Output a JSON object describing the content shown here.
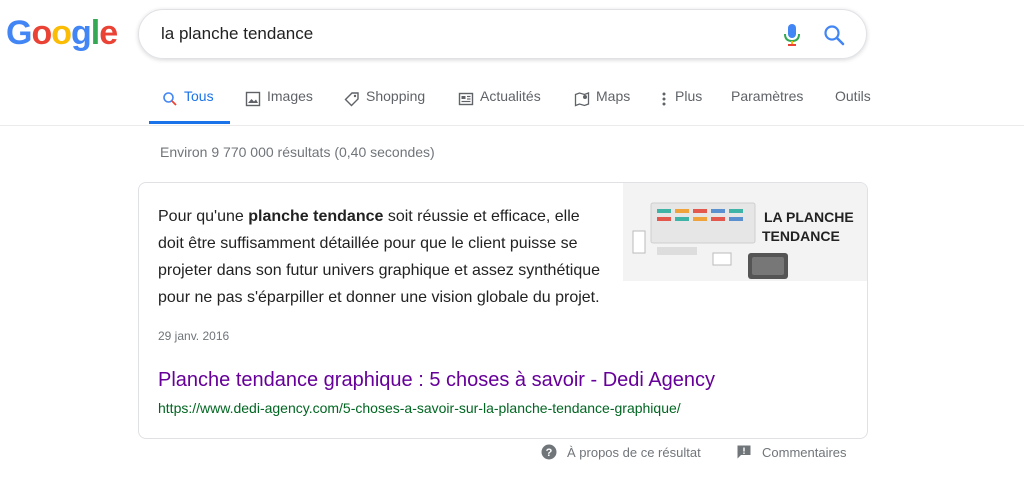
{
  "logo": {
    "letters": [
      "G",
      "o",
      "o",
      "g",
      "l",
      "e"
    ],
    "colors": [
      "#4285F4",
      "#EA4335",
      "#FBBC05",
      "#4285F4",
      "#34A853",
      "#EA4335"
    ]
  },
  "search": {
    "query": "la planche tendance"
  },
  "tabs": [
    {
      "label": "Tous",
      "icon": "search-icon",
      "active": true
    },
    {
      "label": "Images",
      "icon": "image-icon"
    },
    {
      "label": "Shopping",
      "icon": "tag-icon"
    },
    {
      "label": "Actualités",
      "icon": "news-icon"
    },
    {
      "label": "Maps",
      "icon": "map-icon"
    },
    {
      "label": "Plus",
      "icon": "more-vert-icon"
    },
    {
      "label": "Paramètres"
    },
    {
      "label": "Outils"
    }
  ],
  "stats": "Environ 9 770 000 résultats (0,40 secondes)",
  "featured": {
    "snippet_pre": "Pour qu'une ",
    "snippet_bold": "planche tendance",
    "snippet_post": " soit réussie et efficace, elle doit être suffisamment détaillée pour que le client puisse se projeter dans son futur univers graphique et assez synthétique pour ne pas s'éparpiller et donner une vision globale du projet.",
    "date": "29 janv. 2016",
    "title": "Planche tendance graphique : 5 choses à savoir - Dedi Agency",
    "url": "https://www.dedi-agency.com/5-choses-a-savoir-sur-la-planche-tendance-graphique/",
    "thumb_text_line1": "LA PLANCHE",
    "thumb_text_line2": "TENDANCE"
  },
  "footer": {
    "about": "À propos de ce résultat",
    "feedback": "Commentaires"
  },
  "colors": {
    "accent": "#1a73e8",
    "visited": "#660099",
    "url": "#006621",
    "muted": "#70757a"
  }
}
